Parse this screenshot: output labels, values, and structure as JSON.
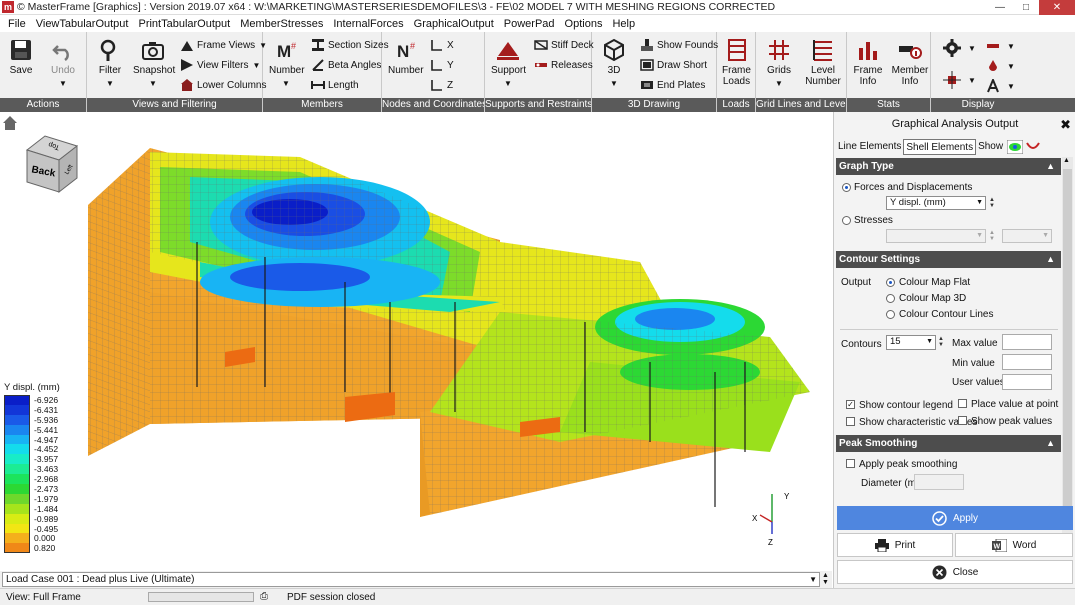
{
  "window": {
    "title": "© MasterFrame [Graphics] : Version 2019.07 x64 : W:\\MARKETING\\MASTERSERIESDEMOFILES\\3 - FE\\02 MODEL 7 WITH MESHING REGIONS CORRECTED",
    "app_icon": "m"
  },
  "menu": [
    "File",
    "ViewTabularOutput",
    "PrintTabularOutput",
    "MemberStresses",
    "InternalForces",
    "GraphicalOutput",
    "PowerPad",
    "Options",
    "Help"
  ],
  "ribbon": {
    "groups": [
      {
        "label": "Actions"
      },
      {
        "label": "Views and Filtering"
      },
      {
        "label": "Members"
      },
      {
        "label": "Nodes and Coordinates"
      },
      {
        "label": "Supports and Restraints"
      },
      {
        "label": "3D Drawing"
      },
      {
        "label": "Loads"
      },
      {
        "label": "Grid Lines and Levels"
      },
      {
        "label": "Stats"
      },
      {
        "label": "Display"
      }
    ],
    "buttons": {
      "save": "Save",
      "undo": "Undo",
      "filter": "Filter",
      "snapshot": "Snapshot",
      "frame_views": "Frame Views",
      "view_filters": "View Filters",
      "lower_columns": "Lower Columns",
      "number_members": "Number",
      "section_sizes": "Section Sizes",
      "beta_angles": "Beta Angles",
      "length": "Length",
      "number_nodes": "Number",
      "axis_x": "X",
      "axis_y": "Y",
      "axis_z": "Z",
      "support": "Support",
      "stiff_deck": "Stiff Deck",
      "releases": "Releases",
      "three_d": "3D",
      "show_founds": "Show Founds",
      "draw_short": "Draw Short",
      "end_plates": "End Plates",
      "frame_loads_1": "Frame",
      "frame_loads_2": "Loads",
      "grids": "Grids",
      "level_number_1": "Level",
      "level_number_2": "Number",
      "frame_info_1": "Frame",
      "frame_info_2": "Info",
      "member_info_1": "Member",
      "member_info_2": "Info"
    }
  },
  "view_cube": {
    "front": "Back",
    "top": "Top",
    "side": "Left"
  },
  "axis_triad": {
    "y": "Y",
    "x": "X",
    "z": "Z"
  },
  "legend": {
    "title": "Y displ. (mm)",
    "entries": [
      {
        "value": "-6.926",
        "color": "#0a1ec8"
      },
      {
        "value": "-6.431",
        "color": "#1236d8"
      },
      {
        "value": "-5.936",
        "color": "#1a5ae8"
      },
      {
        "value": "-5.441",
        "color": "#1a86f0"
      },
      {
        "value": "-4.947",
        "color": "#18b4f4"
      },
      {
        "value": "-4.452",
        "color": "#14dcec"
      },
      {
        "value": "-3.957",
        "color": "#18ecc8"
      },
      {
        "value": "-3.463",
        "color": "#1cec94"
      },
      {
        "value": "-2.968",
        "color": "#1ce45c"
      },
      {
        "value": "-2.473",
        "color": "#2cd834"
      },
      {
        "value": "-1.979",
        "color": "#6ed82c"
      },
      {
        "value": "-1.484",
        "color": "#a6e41c"
      },
      {
        "value": "-0.989",
        "color": "#d8ec14"
      },
      {
        "value": "-0.495",
        "color": "#f2e614"
      },
      {
        "value": "0.000",
        "color": "#f4b01c"
      },
      {
        "value": "0.820",
        "color": "#f08818"
      }
    ]
  },
  "load_case": "Load Case 001 : Dead plus Live (Ultimate)",
  "status": {
    "view": "View: Full Frame",
    "pdf": "PDF session closed"
  },
  "panel": {
    "title": "Graphical Analysis Output",
    "tabs": {
      "line": "Line Elements",
      "shell": "Shell Elements",
      "show": "Show"
    },
    "graph_type": {
      "header": "Graph Type",
      "forces": "Forces and Displacements",
      "forces_select": "Y displ. (mm)",
      "stresses": "Stresses"
    },
    "contour": {
      "header": "Contour Settings",
      "output_label": "Output",
      "flat": "Colour Map Flat",
      "map3d": "Colour Map 3D",
      "lines": "Colour Contour Lines",
      "contours_label": "Contours",
      "contours_value": "15",
      "max_value": "Max value",
      "min_value": "Min value",
      "user_values": "User values",
      "show_legend": "Show contour legend",
      "place_value": "Place value at point",
      "show_char": "Show characteristic values",
      "show_peak": "Show peak values"
    },
    "peak": {
      "header": "Peak Smoothing",
      "apply_smoothing": "Apply peak smoothing",
      "diameter": "Diameter (m)"
    },
    "buttons": {
      "apply": "Apply",
      "print": "Print",
      "word": "Word",
      "close": "Close"
    }
  }
}
